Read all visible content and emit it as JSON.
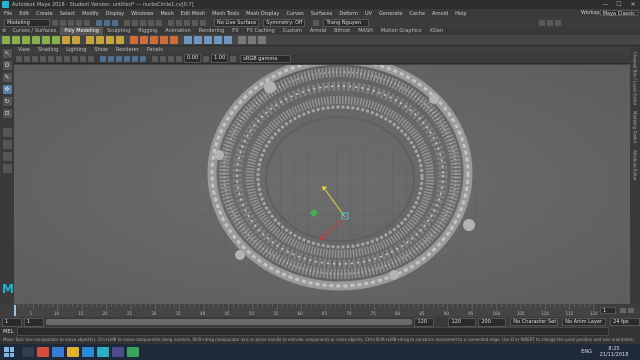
{
  "window": {
    "title": "Autodesk Maya 2018 - Student Version: untitled* --- nurbsCircle1.cv[0:7]",
    "controls": [
      "—",
      "☐",
      "✕"
    ]
  },
  "menu": [
    "File",
    "Edit",
    "Create",
    "Select",
    "Modify",
    "Display",
    "Windows",
    "Mesh",
    "Edit Mesh",
    "Mesh Tools",
    "Mesh Display",
    "Curves",
    "Surfaces",
    "Deform",
    "UV",
    "Generate",
    "Cache",
    "Arnold",
    "Help"
  ],
  "status_line": {
    "mode": "Modeling",
    "live_surface": "No Live Surface",
    "symmetry": "Symmetry: Off",
    "user": "Trang Nguyen",
    "workspace_label": "Workspace:",
    "workspace": "Maya Classic"
  },
  "shelf_tabs": [
    "Curves / Surfaces",
    "Poly Modeling",
    "Sculpting",
    "Rigging",
    "Animation",
    "Rendering",
    "FX",
    "FX Caching",
    "Custom",
    "Arnold",
    "Bifrost",
    "MASH",
    "Motion Graphics",
    "XGen"
  ],
  "shelf_active": "Poly Modeling",
  "viewport": {
    "menu": [
      "View",
      "Shading",
      "Lighting",
      "Show",
      "Renderer",
      "Panels"
    ],
    "exposure": "0.00",
    "gamma": "1.00",
    "color_space": "sRGB gamma"
  },
  "right_dock": [
    "Channel Box / Layer Editor",
    "Modeling Toolkit",
    "Attribute Editor"
  ],
  "time_slider": {
    "ticks": [
      "5",
      "10",
      "15",
      "20",
      "25",
      "30",
      "35",
      "40",
      "45",
      "50",
      "55",
      "60",
      "65",
      "70",
      "75",
      "80",
      "85",
      "90",
      "95",
      "100",
      "105",
      "110",
      "115",
      "120"
    ],
    "current": "1"
  },
  "range_slider": {
    "start": "1",
    "inner_start": "1",
    "inner_end": "120",
    "end": "120",
    "end2": "200",
    "character": "No Character Set",
    "anim_layer": "No Anim Layer",
    "fps": "24 fps"
  },
  "command_line": {
    "label": "MEL"
  },
  "help_line": "Move Tool: Use manipulator to move object(s). Ctrl+LMB to move components along normals. Shift+drag manipulator axis or plane handle to extrude components or clone objects. Ctrl+Shift+LMB+drag to constrain movement to a connected edge. Use D or INSERT to change the pivot position and axis orientation.",
  "taskbar": {
    "lang": "ENG",
    "time": "8:25",
    "date": "21/11/2018"
  }
}
